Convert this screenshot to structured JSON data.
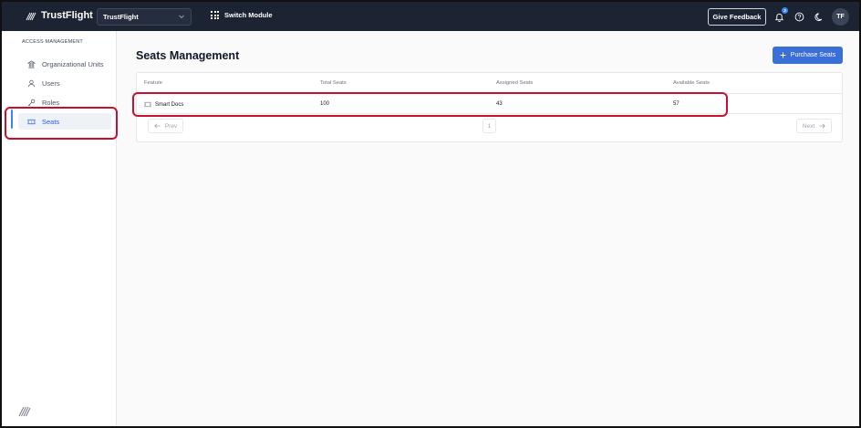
{
  "brand": {
    "name": "TrustFlight"
  },
  "header": {
    "org_select": "TrustFlight",
    "switch_module": "Switch Module",
    "feedback": "Give Feedback",
    "notification_count": "3",
    "avatar_initials": "TF"
  },
  "sidebar": {
    "heading": "ACCESS MANAGEMENT",
    "items": [
      {
        "label": "Organizational Units",
        "icon": "building-icon"
      },
      {
        "label": "Users",
        "icon": "user-icon"
      },
      {
        "label": "Roles",
        "icon": "key-icon"
      },
      {
        "label": "Seats",
        "icon": "ticket-icon",
        "active": true
      }
    ]
  },
  "main": {
    "title": "Seats Management",
    "purchase_button": "Purchase Seats",
    "table": {
      "columns": [
        "Feature",
        "Total Seats",
        "Assigned Seats",
        "Available Seats"
      ],
      "rows": [
        {
          "feature": "Smart Docs",
          "total": "100",
          "assigned": "43",
          "available": "57"
        }
      ]
    },
    "pagination": {
      "prev": "Prev",
      "page": "1",
      "next": "Next"
    }
  },
  "colors": {
    "topbar": "#1c2333",
    "accent": "#3b6fd8",
    "highlight": "#c8102e"
  }
}
